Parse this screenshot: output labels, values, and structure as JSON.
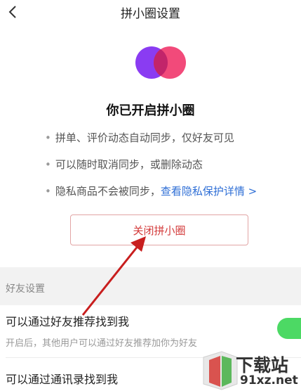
{
  "nav": {
    "title": "拼小圈设置"
  },
  "headline": "你已开启拼小圈",
  "bullets": [
    "拼单、评价动态自动同步，仅好友可见",
    "可以随时取消同步，或删除动态",
    "隐私商品不会被同步，"
  ],
  "privacy_link": "查看隐私保护详情 >",
  "close_button": "关闭拼小圈",
  "friend_settings": {
    "section_title": "好友设置",
    "rows": [
      {
        "title": "可以通过好友推荐找到我",
        "desc": "开启后，其他用户可以通过好友推荐加你为好友",
        "toggle_on": true
      },
      {
        "title": "可以通过通讯录找到我"
      }
    ]
  },
  "watermark": {
    "text": "下载站",
    "domain": "91xz.net"
  },
  "colors": {
    "accent_red": "#d33a3a",
    "toggle_green": "#4cd964",
    "link_blue": "#2f6fd6",
    "logo_purple": "#8a3cf2",
    "logo_pink": "#f24a7a"
  }
}
